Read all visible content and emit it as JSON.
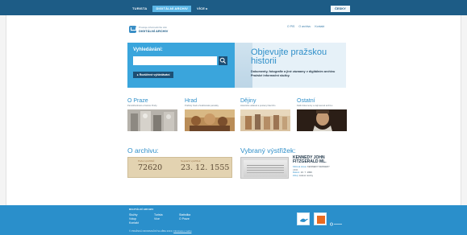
{
  "nav": {
    "tabs": [
      {
        "label": "TURISTA"
      },
      {
        "label": "DIGITÁLNÍ ARCHIV",
        "active": true
      },
      {
        "label": "VÍCE ▸"
      }
    ],
    "language_button": "ČESKY"
  },
  "logo": {
    "small": "Prostoje informačního sítě",
    "big": "DIGITÁLNÍ ARCHIV"
  },
  "util_links": [
    "O PIS",
    "O archivu",
    "Kontakt"
  ],
  "search": {
    "label": "Vyhledávání:",
    "placeholder": "",
    "advanced_label": "▸ Rozšířené vyhledávání"
  },
  "hero": {
    "title": "Objevujte pražskou historii",
    "text": "Dokumenty, fotografie a jiné záznamy v digitálním archivu Pražské informační služby."
  },
  "categories": [
    {
      "title": "O Praze",
      "subtitle": "Pamětihodnosti a historie Prahy"
    },
    {
      "title": "Hrad",
      "subtitle": "Pražský hrad a hradčanské památky"
    },
    {
      "title": "Dějiny",
      "subtitle": "Historické události a postavy hlavního"
    },
    {
      "title": "Ostatní",
      "subtitle": "Další dokumenty a zajímavosti archivu"
    }
  ],
  "archive": {
    "title": "O archivu:",
    "count_label": "Počet výstřižků:",
    "count_value": "72620",
    "oldest_label": "Nejstarší výstřižek:",
    "oldest_value": "23. 12. 1555"
  },
  "clipping": {
    "title": "Vybraný výstřižek:",
    "headline": "KENNEDY JOHN FITZGERALD ML.",
    "meta_rows": [
      {
        "k": "Klíčová slova:",
        "v": "KENNEDY KENNEDY"
      },
      {
        "k": "",
        "v": "J.F.K."
      },
      {
        "k": "Datum:",
        "v": "16. 7. 1999"
      },
      {
        "k": "Zdroj:",
        "v": "Lidové noviny"
      }
    ]
  },
  "footer": {
    "heading": "DIGITÁLNÍ ARCHIV",
    "col1": [
      "Služby",
      "Vstup",
      "Kontakt"
    ],
    "col2": [
      "Turista",
      "Více"
    ],
    "col3": [
      "Statistika",
      "O Praze"
    ],
    "copyright": "© PRAŽSKÁ INFORMAČNÍ SLUŽBA 2013",
    "legal": "Informace o webu"
  },
  "colors": {
    "header": "#1d5c86",
    "accent": "#3aa5dc",
    "footer": "#2a8fcb",
    "archive_paper": "#e3d3b1"
  }
}
